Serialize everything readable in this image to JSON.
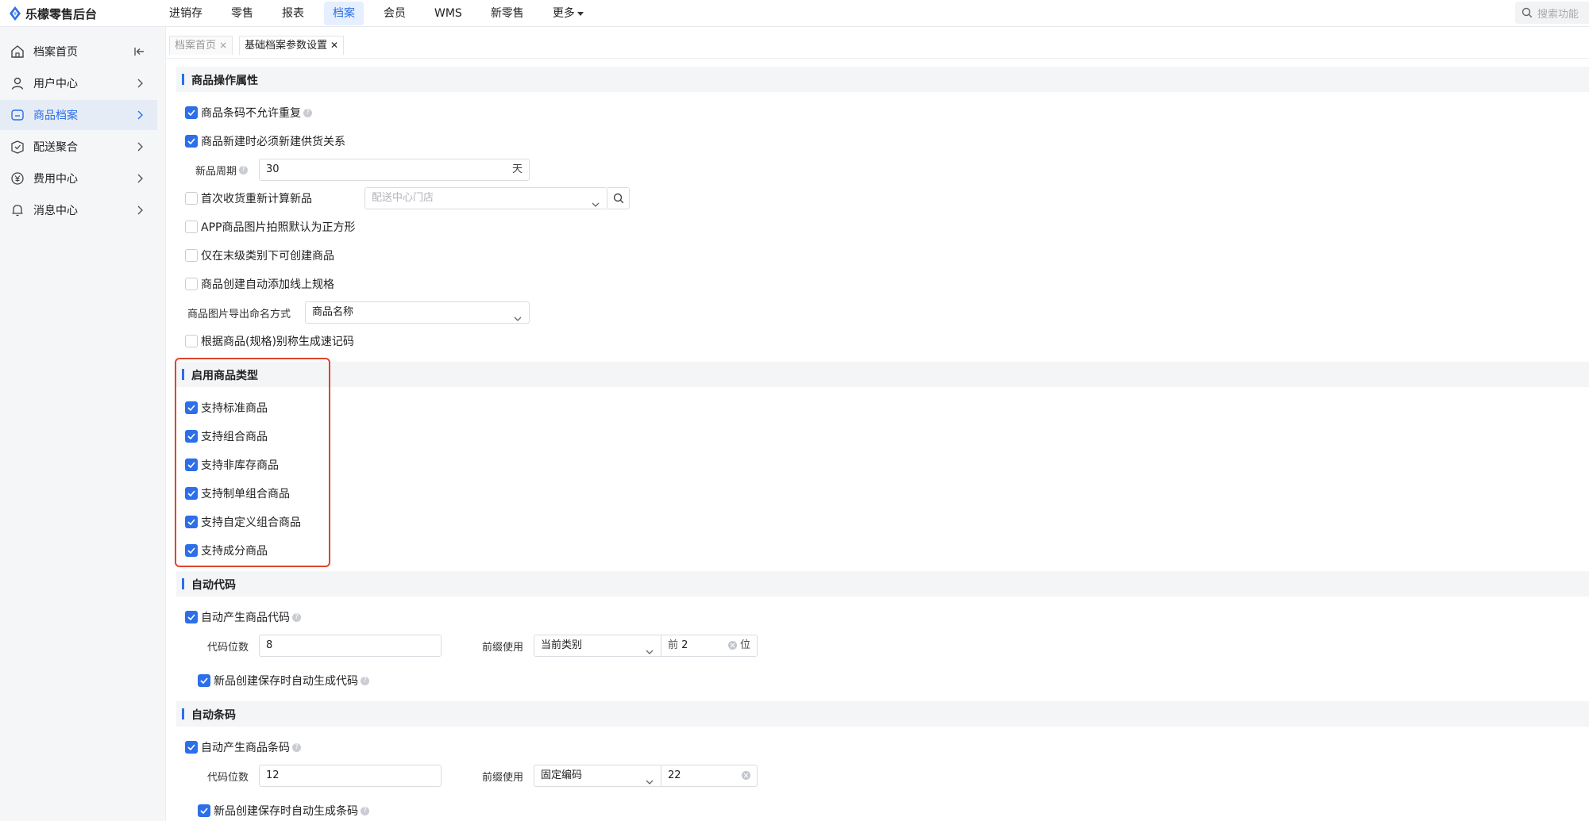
{
  "app": {
    "title": "乐檬零售后台"
  },
  "nav": {
    "items": [
      "进销存",
      "零售",
      "报表",
      "档案",
      "会员",
      "WMS",
      "新零售"
    ],
    "more_label": "更多",
    "active_index": 3
  },
  "search": {
    "placeholder": "搜索功能"
  },
  "sidebar": {
    "items": [
      {
        "label": "档案首页",
        "icon": "home-icon"
      },
      {
        "label": "用户中心",
        "icon": "user-icon"
      },
      {
        "label": "商品档案",
        "icon": "goods-icon"
      },
      {
        "label": "配送聚合",
        "icon": "delivery-icon"
      },
      {
        "label": "费用中心",
        "icon": "yen-icon"
      },
      {
        "label": "消息中心",
        "icon": "bell-icon"
      }
    ],
    "active_index": 2
  },
  "tabs": [
    {
      "label": "档案首页",
      "close": "×"
    },
    {
      "label": "基础档案参数设置",
      "close": "✕"
    }
  ],
  "sections": {
    "goods_ops": {
      "title": "商品操作属性",
      "barcode_no_dup": {
        "label": "商品条码不允许重复",
        "checked": true
      },
      "must_supply": {
        "label": "商品新建时必须新建供货关系",
        "checked": true
      },
      "new_cycle": {
        "label": "新品周期",
        "value": "30",
        "unit": "天"
      },
      "first_receive": {
        "label": "首次收货重新计算新品",
        "checked": false,
        "placeholder": "配送中心门店"
      },
      "app_square": {
        "label": "APP商品图片拍照默认为正方形",
        "checked": false
      },
      "leaf_only": {
        "label": "仅在末级类别下可创建商品",
        "checked": false
      },
      "auto_spec": {
        "label": "商品创建自动添加线上规格",
        "checked": false
      },
      "image_naming": {
        "label": "商品图片导出命名方式",
        "value": "商品名称"
      },
      "mnemonic": {
        "label": "根据商品(规格)别称生成速记码",
        "checked": false
      }
    },
    "goods_types": {
      "title": "启用商品类型",
      "items": [
        {
          "label": "支持标准商品",
          "checked": true
        },
        {
          "label": "支持组合商品",
          "checked": true
        },
        {
          "label": "支持非库存商品",
          "checked": true
        },
        {
          "label": "支持制单组合商品",
          "checked": true
        },
        {
          "label": "支持自定义组合商品",
          "checked": true
        },
        {
          "label": "支持成分商品",
          "checked": true
        }
      ]
    },
    "auto_code": {
      "title": "自动代码",
      "auto_gen": {
        "label": "自动产生商品代码",
        "checked": true
      },
      "digits_label": "代码位数",
      "digits_value": "8",
      "prefix_label": "前缀使用",
      "prefix_value": "当前类别",
      "front_label": "前",
      "front_value": "2",
      "unit": "位",
      "on_save": {
        "label": "新品创建保存时自动生成代码",
        "checked": true
      }
    },
    "auto_barcode": {
      "title": "自动条码",
      "auto_gen": {
        "label": "自动产生商品条码",
        "checked": true
      },
      "digits_label": "代码位数",
      "digits_value": "12",
      "prefix_label": "前缀使用",
      "prefix_value": "固定编码",
      "fixed_value": "22",
      "on_save": {
        "label": "新品创建保存时自动生成条码",
        "checked": true
      }
    }
  },
  "colors": {
    "accent": "#2c6fe8",
    "highlight": "#e0452d"
  }
}
